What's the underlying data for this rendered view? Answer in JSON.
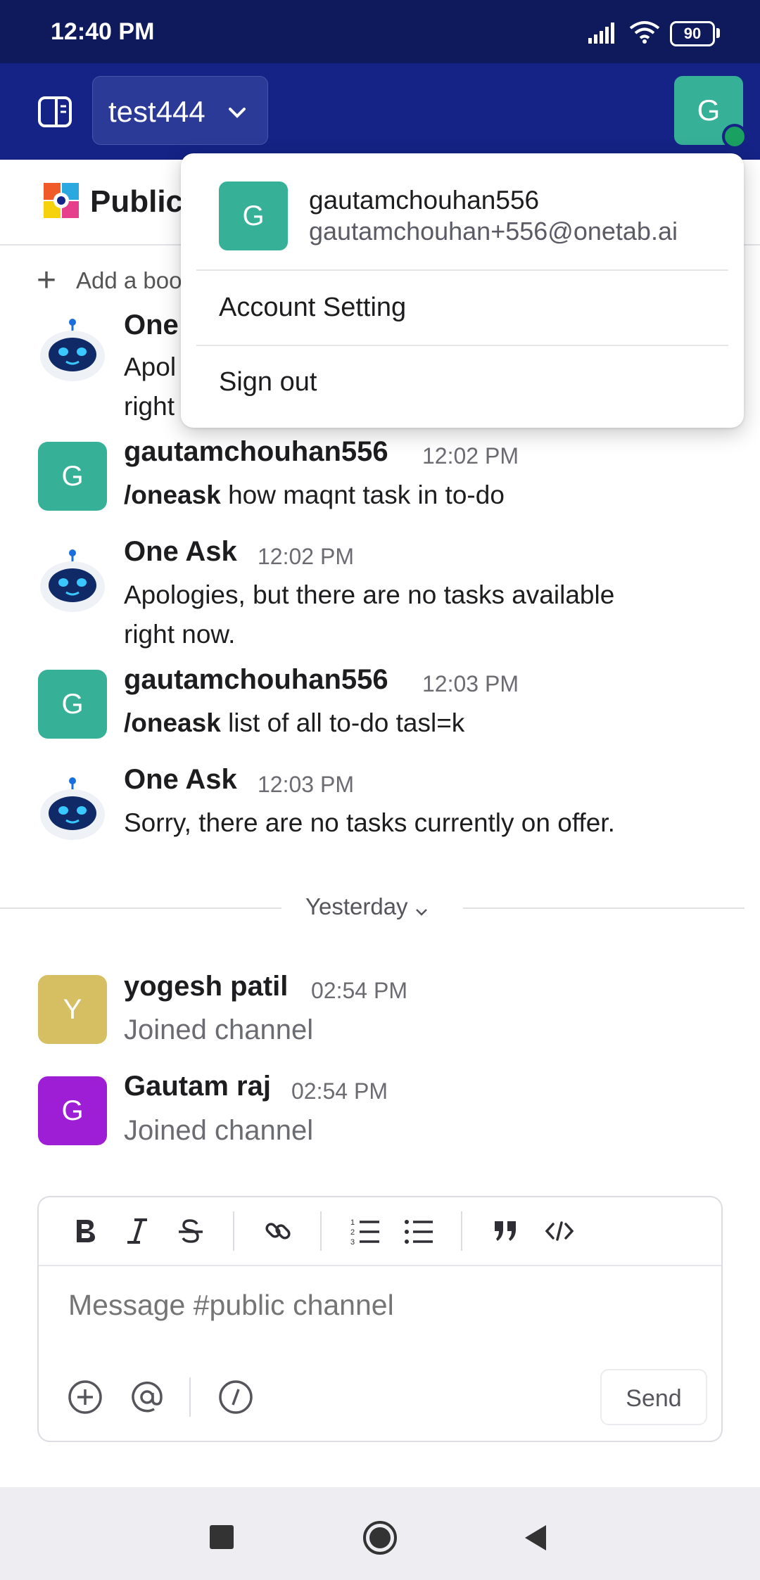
{
  "status_bar": {
    "time": "12:40 PM",
    "battery": "90"
  },
  "header": {
    "workspace": "test444",
    "avatar_initial": "G"
  },
  "channel": {
    "title": "Public",
    "add_bookmark": "Add a boo"
  },
  "messages": [
    {
      "name": "One",
      "time": "",
      "text_lines": [
        "Apol",
        "right"
      ]
    },
    {
      "name": "gautamchouhan556",
      "time": "12:02 PM",
      "command": "/oneask",
      "text": "how maqnt task in to-do",
      "initial": "G"
    },
    {
      "name": "One Ask",
      "time": "12:02 PM",
      "text_lines": [
        "Apologies, but there are no tasks available",
        "right now."
      ]
    },
    {
      "name": "gautamchouhan556",
      "time": "12:03 PM",
      "command": "/oneask",
      "text": "list of all to-do tasl=k",
      "initial": "G"
    },
    {
      "name": "One Ask",
      "time": "12:03 PM",
      "text_lines": [
        "Sorry, there are no tasks currently on offer."
      ]
    },
    {
      "name": "yogesh patil",
      "time": "02:54 PM",
      "text": "Joined channel",
      "initial": "Y"
    },
    {
      "name": "Gautam raj",
      "time": "02:54 PM",
      "text": "Joined channel",
      "initial": "G"
    }
  ],
  "day_divider": "Yesterday",
  "composer": {
    "placeholder": "Message #public channel",
    "send_label": "Send"
  },
  "dropdown": {
    "initial": "G",
    "username": "gautamchouhan556",
    "email": "gautamchouhan+556@onetab.ai",
    "items": [
      "Account Setting",
      "Sign out"
    ]
  },
  "colors": {
    "status_bar_bg": "#0f1a5c",
    "header_bg": "#142385",
    "avatar_green": "#36b097",
    "avatar_yellow": "#d6be62",
    "avatar_purple": "#9d1ed4",
    "online": "#1aa061"
  },
  "icons": [
    "signal-icon",
    "wifi-icon",
    "battery-icon",
    "sidebar-toggle-icon",
    "chevron-down-icon",
    "bot-avatar-icon",
    "bold-icon",
    "italic-icon",
    "strikethrough-icon",
    "link-icon",
    "ordered-list-icon",
    "bullet-list-icon",
    "quote-icon",
    "code-icon",
    "plus-circle-icon",
    "mention-icon",
    "slash-command-icon",
    "nav-recents-icon",
    "nav-home-icon",
    "nav-back-icon"
  ]
}
